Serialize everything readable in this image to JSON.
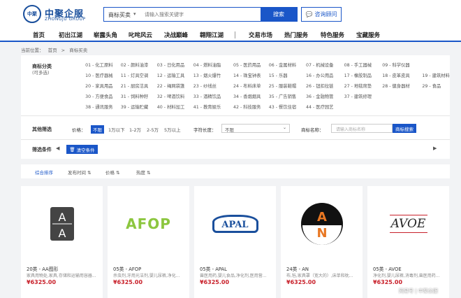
{
  "header": {
    "logo_mark": "中聚",
    "logo_cn": "中聚企服",
    "logo_en": "ZHONGJU GROUP",
    "search_category": "商标买卖",
    "search_placeholder": "请输入搜索关键字",
    "search_button": "搜索",
    "consult_button": "咨询顾问"
  },
  "nav": {
    "items": [
      "首页",
      "初出江湖",
      "崭露头角",
      "叱咤风云",
      "决战巅峰",
      "翱翔江湖",
      "交易市场",
      "热门服务",
      "特色服务",
      "宝藏服务"
    ]
  },
  "breadcrumb": [
    "当前位置：",
    "首页",
    ">",
    "商标买卖"
  ],
  "filter": {
    "cat_label": "商标分类",
    "cat_sub": "(可多选)",
    "categories": [
      "01 - 化工原料",
      "02 - 颜料油漆",
      "03 - 日化用品",
      "04 - 燃料油脂",
      "05 - 医药用品",
      "06 - 金属材料",
      "07 - 机械设备",
      "08 - 手工器械",
      "09 - 科学仪器",
      "10 - 医疗器械",
      "11 - 灯具空调",
      "12 - 运输工具",
      "13 - 烟火爆竹",
      "14 - 珠宝钟表",
      "15 - 乐器",
      "16 - 办公用品",
      "17 - 橡胶制品",
      "18 - 皮革皮具",
      "19 - 建筑材料",
      "20 - 家具用品",
      "21 - 厨房洁具",
      "22 - 绳网袋篷",
      "23 - 纱线丝",
      "24 - 布料床单",
      "25 - 服装鞋帽",
      "26 - 钮扣拉链",
      "27 - 地毯席垫",
      "28 - 健身器材",
      "29 - 食品",
      "30 - 方便食品",
      "31 - 饲料种籽",
      "32 - 啤酒饮料",
      "33 - 酒精饮品",
      "34 - 香烟烟具",
      "35 - 广告销售",
      "36 - 金融物管",
      "37 - 建筑修理",
      "38 - 通讯服务",
      "39 - 运输贮藏",
      "40 - 材料加工",
      "41 - 教育娱乐",
      "42 - 科技服务",
      "43 - 餐饮住宿",
      "44 - 医疗园艺",
      "45 - 社会服务"
    ],
    "other_label": "其他筛选",
    "price_label": "价格：",
    "price_options": [
      "不限",
      "1万以下",
      "1-2万",
      "2-5万",
      "5万以上"
    ],
    "length_label": "字符长度：",
    "length_value": "不限",
    "name_label": "商标名称：",
    "name_placeholder": "请输入商标名称",
    "name_button": "商标搜索",
    "cond_label": "筛选条件",
    "clear_button": "清空条件",
    "prev_arrow": "◀",
    "next_arrow": "▶"
  },
  "sortbar": {
    "items": [
      "综合排序",
      "发布时间 ⇅",
      "价格 ⇅",
      "热度 ⇅"
    ]
  },
  "products": [
    {
      "title": "20类 - AA图形",
      "desc": "家具用物处,家具,存储和运输用容器...",
      "price": "¥6325.00",
      "logo": "AA"
    },
    {
      "title": "05类 - AFOP",
      "desc": "杀虫剂,牙用光洁剂,婴儿尿裤,净化...",
      "price": "¥6325.00",
      "logo": "AFOP"
    },
    {
      "title": "05类 - APAL",
      "desc": "兽医用药,婴儿食品,净化剂,医用营...",
      "price": "¥6325.00",
      "logo": "APAL"
    },
    {
      "title": "24类 - AN",
      "desc": "布,毡,家具罩（宽大的）,床单和枕...",
      "price": "¥6325.00",
      "logo": "AN"
    },
    {
      "title": "05类 - AVOE",
      "desc": "净化剂,婴儿尿裤,消毒剂,兽医用药...",
      "price": "¥6325.00",
      "logo": "AVOE"
    }
  ],
  "watermark": "网易号 | 中聚企服",
  "colors": {
    "accent": "#1a56c8",
    "price": "#c8202a",
    "brand": "#1a4f9c"
  }
}
